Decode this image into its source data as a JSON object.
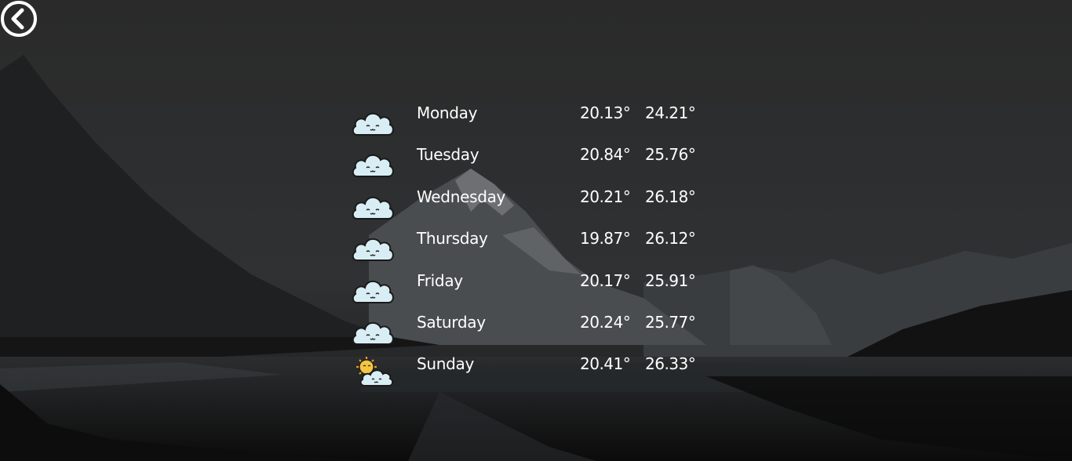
{
  "forecast": {
    "days": [
      {
        "day": "Monday",
        "min": "20.13°",
        "max": "24.21°",
        "icon": "cloud-icon"
      },
      {
        "day": "Tuesday",
        "min": "20.84°",
        "max": "25.76°",
        "icon": "cloud-icon"
      },
      {
        "day": "Wednesday",
        "min": "20.21°",
        "max": "26.18°",
        "icon": "cloud-icon"
      },
      {
        "day": "Thursday",
        "min": "19.87°",
        "max": "26.12°",
        "icon": "cloud-icon"
      },
      {
        "day": "Friday",
        "min": "20.17°",
        "max": "25.91°",
        "icon": "cloud-icon"
      },
      {
        "day": "Saturday",
        "min": "20.24°",
        "max": "25.77°",
        "icon": "cloud-icon"
      },
      {
        "day": "Sunday",
        "min": "20.41°",
        "max": "26.33°",
        "icon": "sun-cloud-icon"
      }
    ]
  },
  "colors": {
    "text": "#ffffff",
    "cloud": "#d8eef4",
    "sun": "#f4c542"
  }
}
